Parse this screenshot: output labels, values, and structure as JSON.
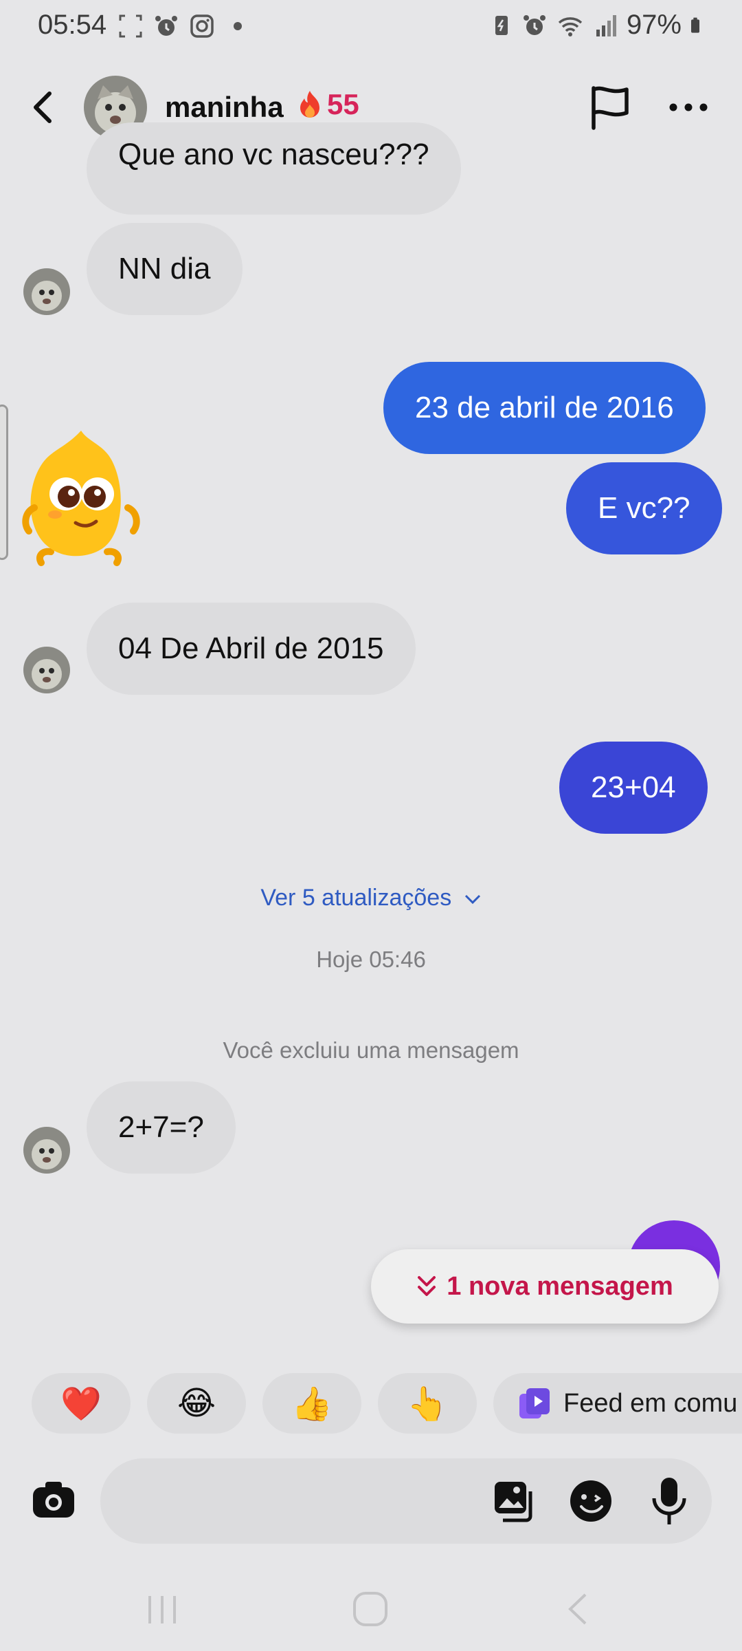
{
  "status_bar": {
    "time": "05:54",
    "battery_text": "97%",
    "left_icons": [
      "screenshot-icon",
      "alarm-icon",
      "instagram-icon",
      "dot-icon"
    ],
    "right_icons": [
      "battery-saver-icon",
      "alarm-icon",
      "wifi-icon",
      "signal-icon",
      "battery-icon"
    ]
  },
  "header": {
    "contact_name": "maninha",
    "streak_count": "55",
    "icons": [
      "back-icon",
      "flame-icon",
      "flag-icon",
      "more-icon"
    ]
  },
  "messages": [
    {
      "side": "in",
      "text": "Que ano vc nasceu???"
    },
    {
      "side": "in",
      "text": "NN dia"
    },
    {
      "side": "out",
      "text": "23 de abril de 2016"
    },
    {
      "side": "out",
      "text": "E vc??"
    },
    {
      "side": "in",
      "type": "sticker",
      "sticker": "yellow-character-sticker"
    },
    {
      "side": "in",
      "text": "04 De Abril de 2015"
    },
    {
      "side": "out",
      "text": "23+04"
    },
    {
      "side": "in",
      "text": "2+7=?"
    }
  ],
  "updates_link": "Ver 5 atualizações",
  "timestamp": "Hoje 05:46",
  "deleted_note": "Você excluiu uma mensagem",
  "new_message_pill": "1 nova mensagem",
  "quick_reactions": [
    {
      "emoji": "❤️",
      "name": "heart"
    },
    {
      "emoji": "😂",
      "name": "laughing"
    },
    {
      "emoji": "👍",
      "name": "thumbs-up"
    },
    {
      "emoji": "👆",
      "name": "pointing"
    }
  ],
  "feed_chip_label": "Feed em comu",
  "composer": {
    "placeholder": "",
    "icons": [
      "camera-icon",
      "gallery-icon",
      "sticker-icon",
      "microphone-icon"
    ]
  },
  "colors": {
    "outgoing_bubble_start": "#2f66e0",
    "outgoing_bubble_end": "#3a45d6",
    "incoming_bubble": "#dcdcde",
    "streak": "#d6245a",
    "link": "#2f5bc2",
    "new_message": "#c4164a",
    "background": "#e6e6e8"
  }
}
